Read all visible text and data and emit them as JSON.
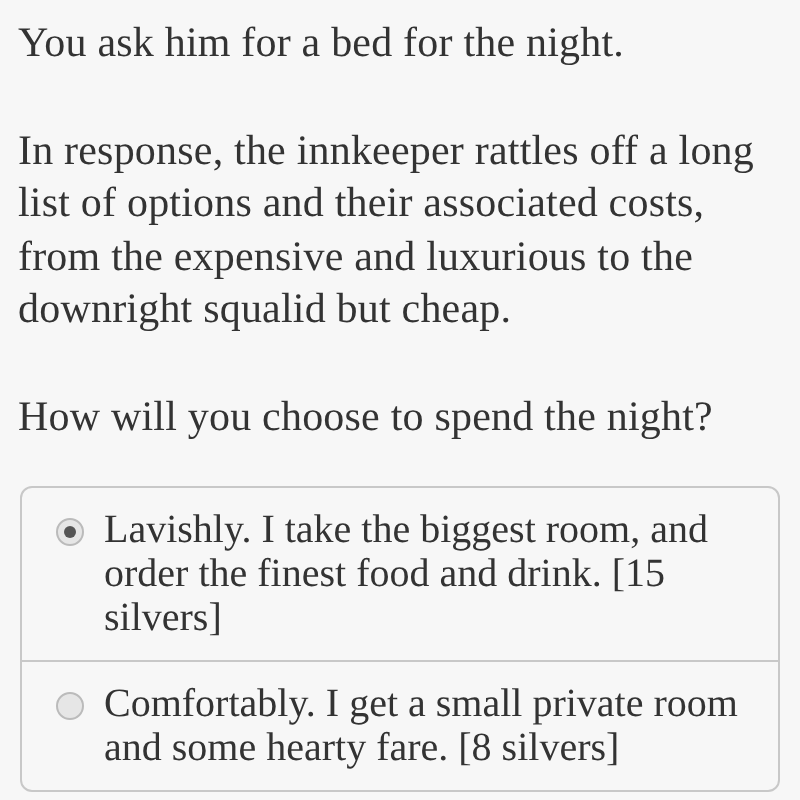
{
  "paragraphs": [
    "You ask him for a bed for the night.",
    "In response, the innkeeper rattles off a long list of options and their associated costs, from the expensive and luxurious to the downright squalid but cheap.",
    "How will you choose to spend the night?"
  ],
  "options": [
    {
      "label": "Lavishly. I take the biggest room, and order the finest food and drink. [15 silvers]",
      "selected": true
    },
    {
      "label": "Comfortably. I get a small private room and some hearty fare. [8 silvers]",
      "selected": false
    }
  ]
}
